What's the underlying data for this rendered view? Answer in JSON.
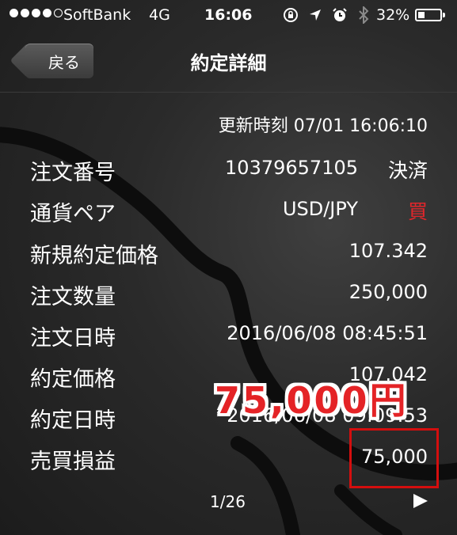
{
  "status_bar": {
    "carrier": "SoftBank",
    "network": "4G",
    "time": "16:06",
    "battery": "32%",
    "battery_level": 0.32
  },
  "nav": {
    "back_label": "戻る",
    "title": "約定詳細"
  },
  "updated": "更新時刻 07/01 16:06:10",
  "order": {
    "order_number_label": "注文番号",
    "order_number": "10379657105",
    "order_status": "決済",
    "pair_label": "通貨ペア",
    "pair": "USD/JPY",
    "side": "買",
    "new_price_label": "新規約定価格",
    "new_price": "107.342",
    "quantity_label": "注文数量",
    "quantity": "250,000",
    "order_datetime_label": "注文日時",
    "order_datetime": "2016/06/08 08:45:51",
    "exec_price_label": "約定価格",
    "exec_price": "107.042",
    "exec_datetime_label": "約定日時",
    "exec_datetime": "2016/06/08 09:09:53",
    "pnl_label": "売買損益",
    "pnl": "75,000"
  },
  "pagination": {
    "page": "1/26"
  },
  "callout": "75,000円",
  "colors": {
    "side": "#e0262b",
    "callout": "#e42326",
    "highlight": "#d40e0e"
  },
  "icons": [
    "lock-rotation-icon",
    "location-arrow-icon",
    "alarm-icon",
    "bluetooth-icon",
    "play-icon"
  ]
}
